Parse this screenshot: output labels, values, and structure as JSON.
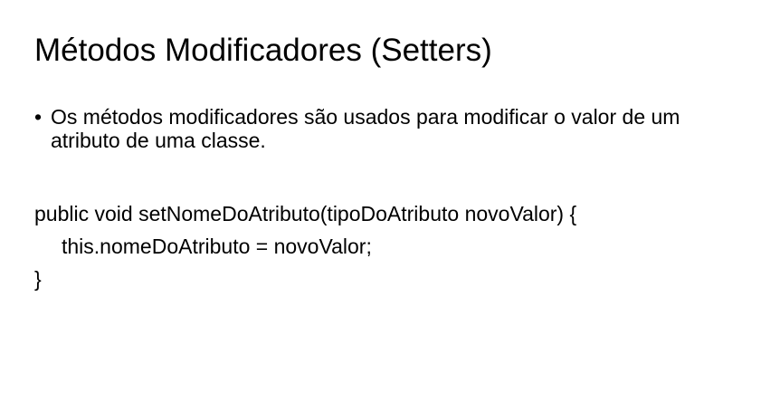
{
  "slide": {
    "title": "Métodos Modificadores  (Setters)",
    "bullets": [
      {
        "marker": "•",
        "text": "Os métodos modificadores são usados para modificar o valor de um atributo de uma classe."
      }
    ],
    "code": {
      "line1": "public void setNomeDoAtributo(tipoDoAtributo novoValor) {",
      "line2": "this.nomeDoAtributo = novoValor;",
      "line3": "}"
    }
  },
  "colors": {
    "background": "#ffffff",
    "text": "#000000"
  }
}
